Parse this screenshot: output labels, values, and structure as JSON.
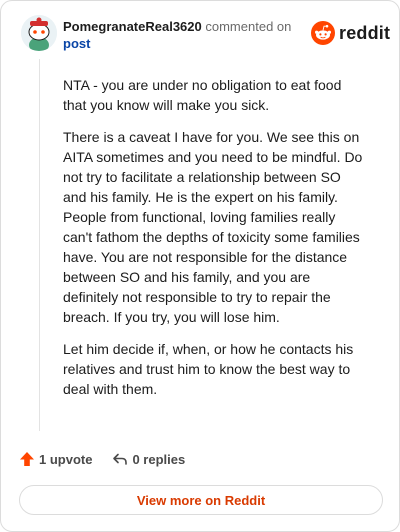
{
  "header": {
    "author": "PomegranateReal3620",
    "action": "commented on",
    "target": "post",
    "brand": "reddit"
  },
  "comment": {
    "paragraphs": [
      "NTA - you are under no obligation to eat food that you know will make you sick.",
      "There is a caveat I have for you. We see this on AITA sometimes and you need to be mindful. Do not try to facilitate a relationship between SO and his family. He is the expert on his family. People from functional, loving families really can't fathom the depths of toxicity some families have. You are not responsible for the distance between SO and his family, and you are definitely not responsible to try to repair the breach. If you try, you will lose him.",
      "Let him decide if, when, or how he contacts his relatives and trust him to know the best way to deal with them."
    ]
  },
  "footer": {
    "upvotes": "1 upvote",
    "replies": "0 replies",
    "view_more": "View more on Reddit"
  },
  "colors": {
    "accent": "#ff4500",
    "link": "#0a45a6",
    "view_more": "#d93a00"
  },
  "icons": [
    "snoo-avatar-icon",
    "reddit-logo-icon",
    "upvote-arrow-icon",
    "reply-arrow-icon"
  ]
}
